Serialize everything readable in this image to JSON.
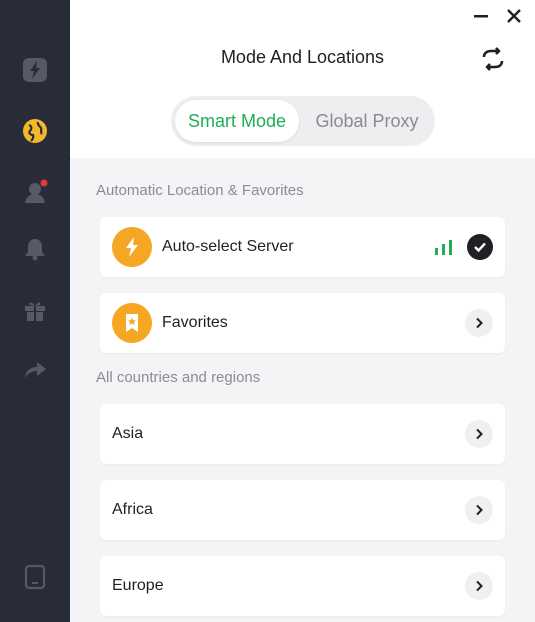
{
  "window": {
    "title": "Mode And Locations",
    "minimize_icon": "minimize-icon",
    "close_icon": "close-icon",
    "refresh_icon": "refresh-icon"
  },
  "sidebar": {
    "items": [
      {
        "name": "connect",
        "icon": "lightning-icon"
      },
      {
        "name": "locations",
        "icon": "globe-icon",
        "active": true
      },
      {
        "name": "account",
        "icon": "user-icon",
        "has_notification": true
      },
      {
        "name": "notifications",
        "icon": "bell-icon"
      },
      {
        "name": "gifts",
        "icon": "gift-icon"
      },
      {
        "name": "share",
        "icon": "share-icon"
      },
      {
        "name": "device",
        "icon": "device-icon"
      }
    ]
  },
  "mode_switch": {
    "options": [
      "Smart Mode",
      "Global Proxy"
    ],
    "selected": "Smart Mode"
  },
  "sections": {
    "favorites_title": "Automatic Location & Favorites",
    "regions_title": "All countries and regions"
  },
  "auto_select": {
    "label": "Auto-select Server",
    "selected": true
  },
  "favorites": {
    "label": "Favorites"
  },
  "regions": [
    {
      "label": "Asia"
    },
    {
      "label": "Africa"
    },
    {
      "label": "Europe"
    }
  ],
  "colors": {
    "sidebar_bg": "#282c38",
    "accent_green": "#1eae57",
    "icon_orange": "#f5a623",
    "notification_red": "#e53935",
    "active_globe": "#f5b72a"
  }
}
